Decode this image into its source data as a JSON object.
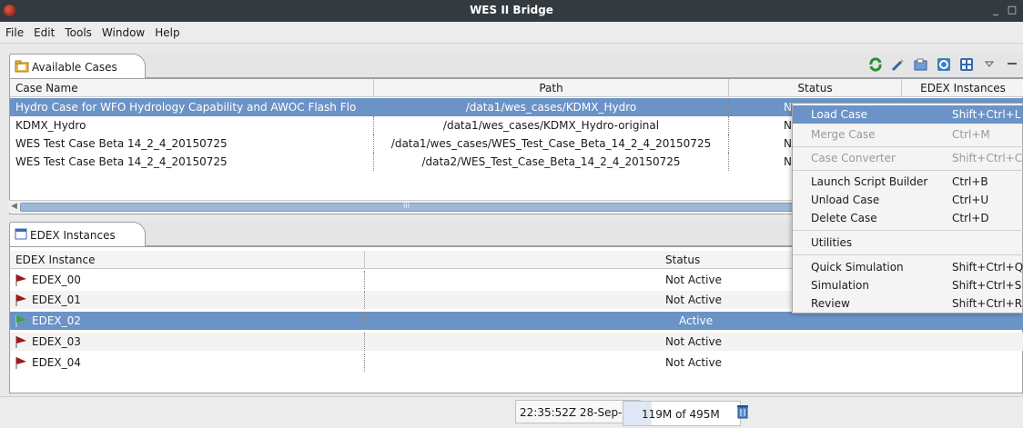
{
  "window": {
    "title": "WES II Bridge",
    "minimize": "_",
    "maximize": "□"
  },
  "menu": [
    "File",
    "Edit",
    "Tools",
    "Window",
    "Help"
  ],
  "cases_panel": {
    "tab_label": "Available Cases",
    "columns": [
      "Case Name",
      "Path",
      "Status",
      "EDEX Instances"
    ],
    "rows": [
      {
        "name": "Hydro Case for WFO Hydrology Capability and AWOC Flash Flo",
        "path": "/data1/wes_cases/KDMX_Hydro",
        "status": "No",
        "selected": true
      },
      {
        "name": "KDMX_Hydro",
        "path": "/data1/wes_cases/KDMX_Hydro-original",
        "status": "No"
      },
      {
        "name": "WES Test Case Beta 14_2_4_20150725",
        "path": "/data1/wes_cases/WES_Test_Case_Beta_14_2_4_20150725",
        "status": "No"
      },
      {
        "name": "WES Test Case Beta 14_2_4_20150725",
        "path": "/data2/WES_Test_Case_Beta_14_2_4_20150725",
        "status": "No"
      }
    ],
    "scroll_glyph": "III"
  },
  "edex_panel": {
    "tab_label": "EDEX Instances",
    "columns": [
      "EDEX Instance",
      "Status"
    ],
    "rows": [
      {
        "name": "EDEX_00",
        "status": "Not Active",
        "flag": "#a01818"
      },
      {
        "name": "EDEX_01",
        "status": "Not Active",
        "flag": "#a01818"
      },
      {
        "name": "EDEX_02",
        "status": "Active",
        "flag": "#3aa63a",
        "selected": true
      },
      {
        "name": "EDEX_03",
        "status": "Not Active",
        "flag": "#a01818"
      },
      {
        "name": "EDEX_04",
        "status": "Not Active",
        "flag": "#a01818"
      }
    ]
  },
  "context_menu": {
    "items": [
      {
        "label": "Load Case",
        "shortcut": "Shift+Ctrl+L",
        "state": "highlighted"
      },
      {
        "label": "Merge Case",
        "shortcut": "Ctrl+M",
        "state": "disabled"
      },
      {
        "label": "Case Converter",
        "shortcut": "Shift+Ctrl+C",
        "state": "disabled"
      },
      {
        "label": "Launch Script Builder",
        "shortcut": "Ctrl+B",
        "state": "enabled"
      },
      {
        "label": "Unload Case",
        "shortcut": "Ctrl+U",
        "state": "enabled"
      },
      {
        "label": "Delete Case",
        "shortcut": "Ctrl+D",
        "state": "enabled"
      },
      {
        "label": "Utilities",
        "shortcut": "",
        "state": "enabled"
      },
      {
        "label": "Quick Simulation",
        "shortcut": "Shift+Ctrl+Q",
        "state": "enabled"
      },
      {
        "label": "Simulation",
        "shortcut": "Shift+Ctrl+S",
        "state": "enabled"
      },
      {
        "label": "Review",
        "shortcut": "Shift+Ctrl+R",
        "state": "enabled"
      }
    ]
  },
  "status_bar": {
    "clock": "22:35:52Z 28-Sep-15",
    "heap": "119M of 495M",
    "heap_used_fraction": 0.24
  },
  "colors": {
    "selection": "#6b93c7",
    "titlebar": "#333a40",
    "flag_inactive": "#a01818",
    "flag_active": "#3aa63a"
  }
}
